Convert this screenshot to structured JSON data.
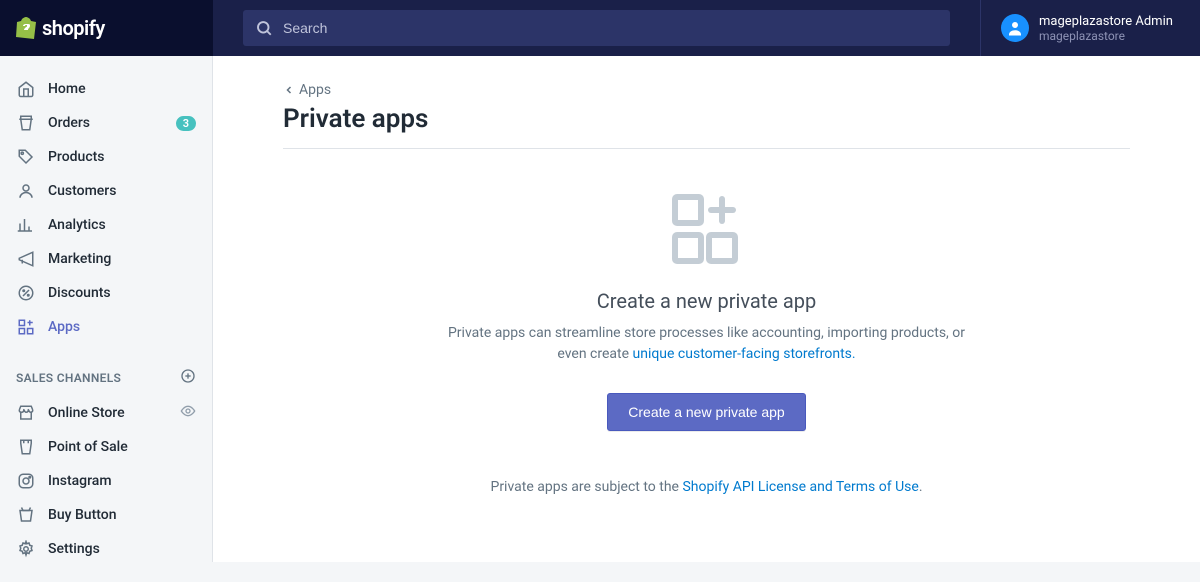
{
  "brand": "shopify",
  "search": {
    "placeholder": "Search"
  },
  "account": {
    "name": "mageplazastore Admin",
    "store": "mageplazastore"
  },
  "sidebar": {
    "items": [
      {
        "label": "Home"
      },
      {
        "label": "Orders",
        "badge": "3"
      },
      {
        "label": "Products"
      },
      {
        "label": "Customers"
      },
      {
        "label": "Analytics"
      },
      {
        "label": "Marketing"
      },
      {
        "label": "Discounts"
      },
      {
        "label": "Apps"
      }
    ],
    "channels_header": "SALES CHANNELS",
    "channels": [
      {
        "label": "Online Store"
      },
      {
        "label": "Point of Sale"
      },
      {
        "label": "Instagram"
      },
      {
        "label": "Buy Button"
      }
    ],
    "settings": "Settings"
  },
  "breadcrumb": {
    "parent": "Apps"
  },
  "page": {
    "title": "Private apps",
    "empty_title": "Create a new private app",
    "empty_desc_pre": "Private apps can streamline store processes like accounting, importing products, or even create ",
    "empty_desc_link": "unique customer-facing storefronts.",
    "cta": "Create a new private app",
    "footer_pre": "Private apps are subject to the ",
    "footer_link": "Shopify API License and Terms of Use"
  }
}
